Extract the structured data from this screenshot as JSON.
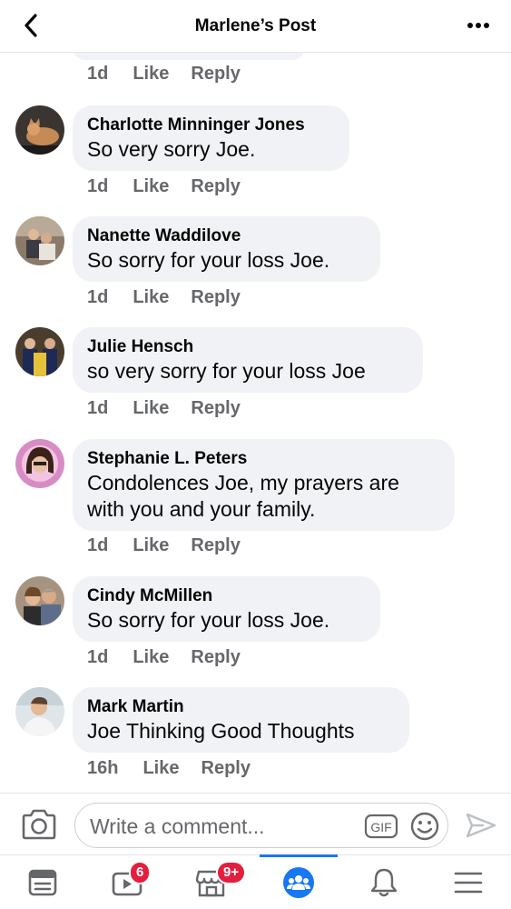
{
  "header": {
    "title": "Marlene’s Post"
  },
  "top_partial": {
    "time": "1d",
    "like": "Like",
    "reply": "Reply"
  },
  "comments": [
    {
      "author": "Charlotte Minninger Jones",
      "lines": [
        "So very sorry Joe."
      ],
      "time": "1d",
      "like": "Like",
      "reply": "Reply"
    },
    {
      "author": "Nanette Waddilove",
      "lines": [
        "So sorry for your loss Joe."
      ],
      "time": "1d",
      "like": "Like",
      "reply": "Reply"
    },
    {
      "author": "Julie Hensch",
      "lines": [
        "so very sorry for your loss Joe"
      ],
      "time": "1d",
      "like": "Like",
      "reply": "Reply"
    },
    {
      "author": "Stephanie L. Peters",
      "lines": [
        "Condolences Joe, my prayers are",
        "with you and your family."
      ],
      "time": "1d",
      "like": "Like",
      "reply": "Reply"
    },
    {
      "author": "Cindy McMillen",
      "lines": [
        "So sorry for your loss Joe."
      ],
      "time": "1d",
      "like": "Like",
      "reply": "Reply"
    },
    {
      "author": "Mark Martin",
      "lines": [
        "Joe Thinking Good Thoughts"
      ],
      "time": "16h",
      "like": "Like",
      "reply": "Reply"
    }
  ],
  "composer": {
    "placeholder": "Write a comment...",
    "gif_label": "GIF"
  },
  "tabbar": {
    "badges": {
      "watch": "6",
      "marketplace": "9+"
    },
    "icons": [
      "news-feed-icon",
      "watch-icon",
      "marketplace-icon",
      "groups-icon",
      "bell-icon",
      "menu-icon"
    ]
  },
  "colors": {
    "accent": "#1877f2",
    "badge": "#e41e3f",
    "bubble": "#f0f2f5",
    "meta": "#65676b"
  }
}
